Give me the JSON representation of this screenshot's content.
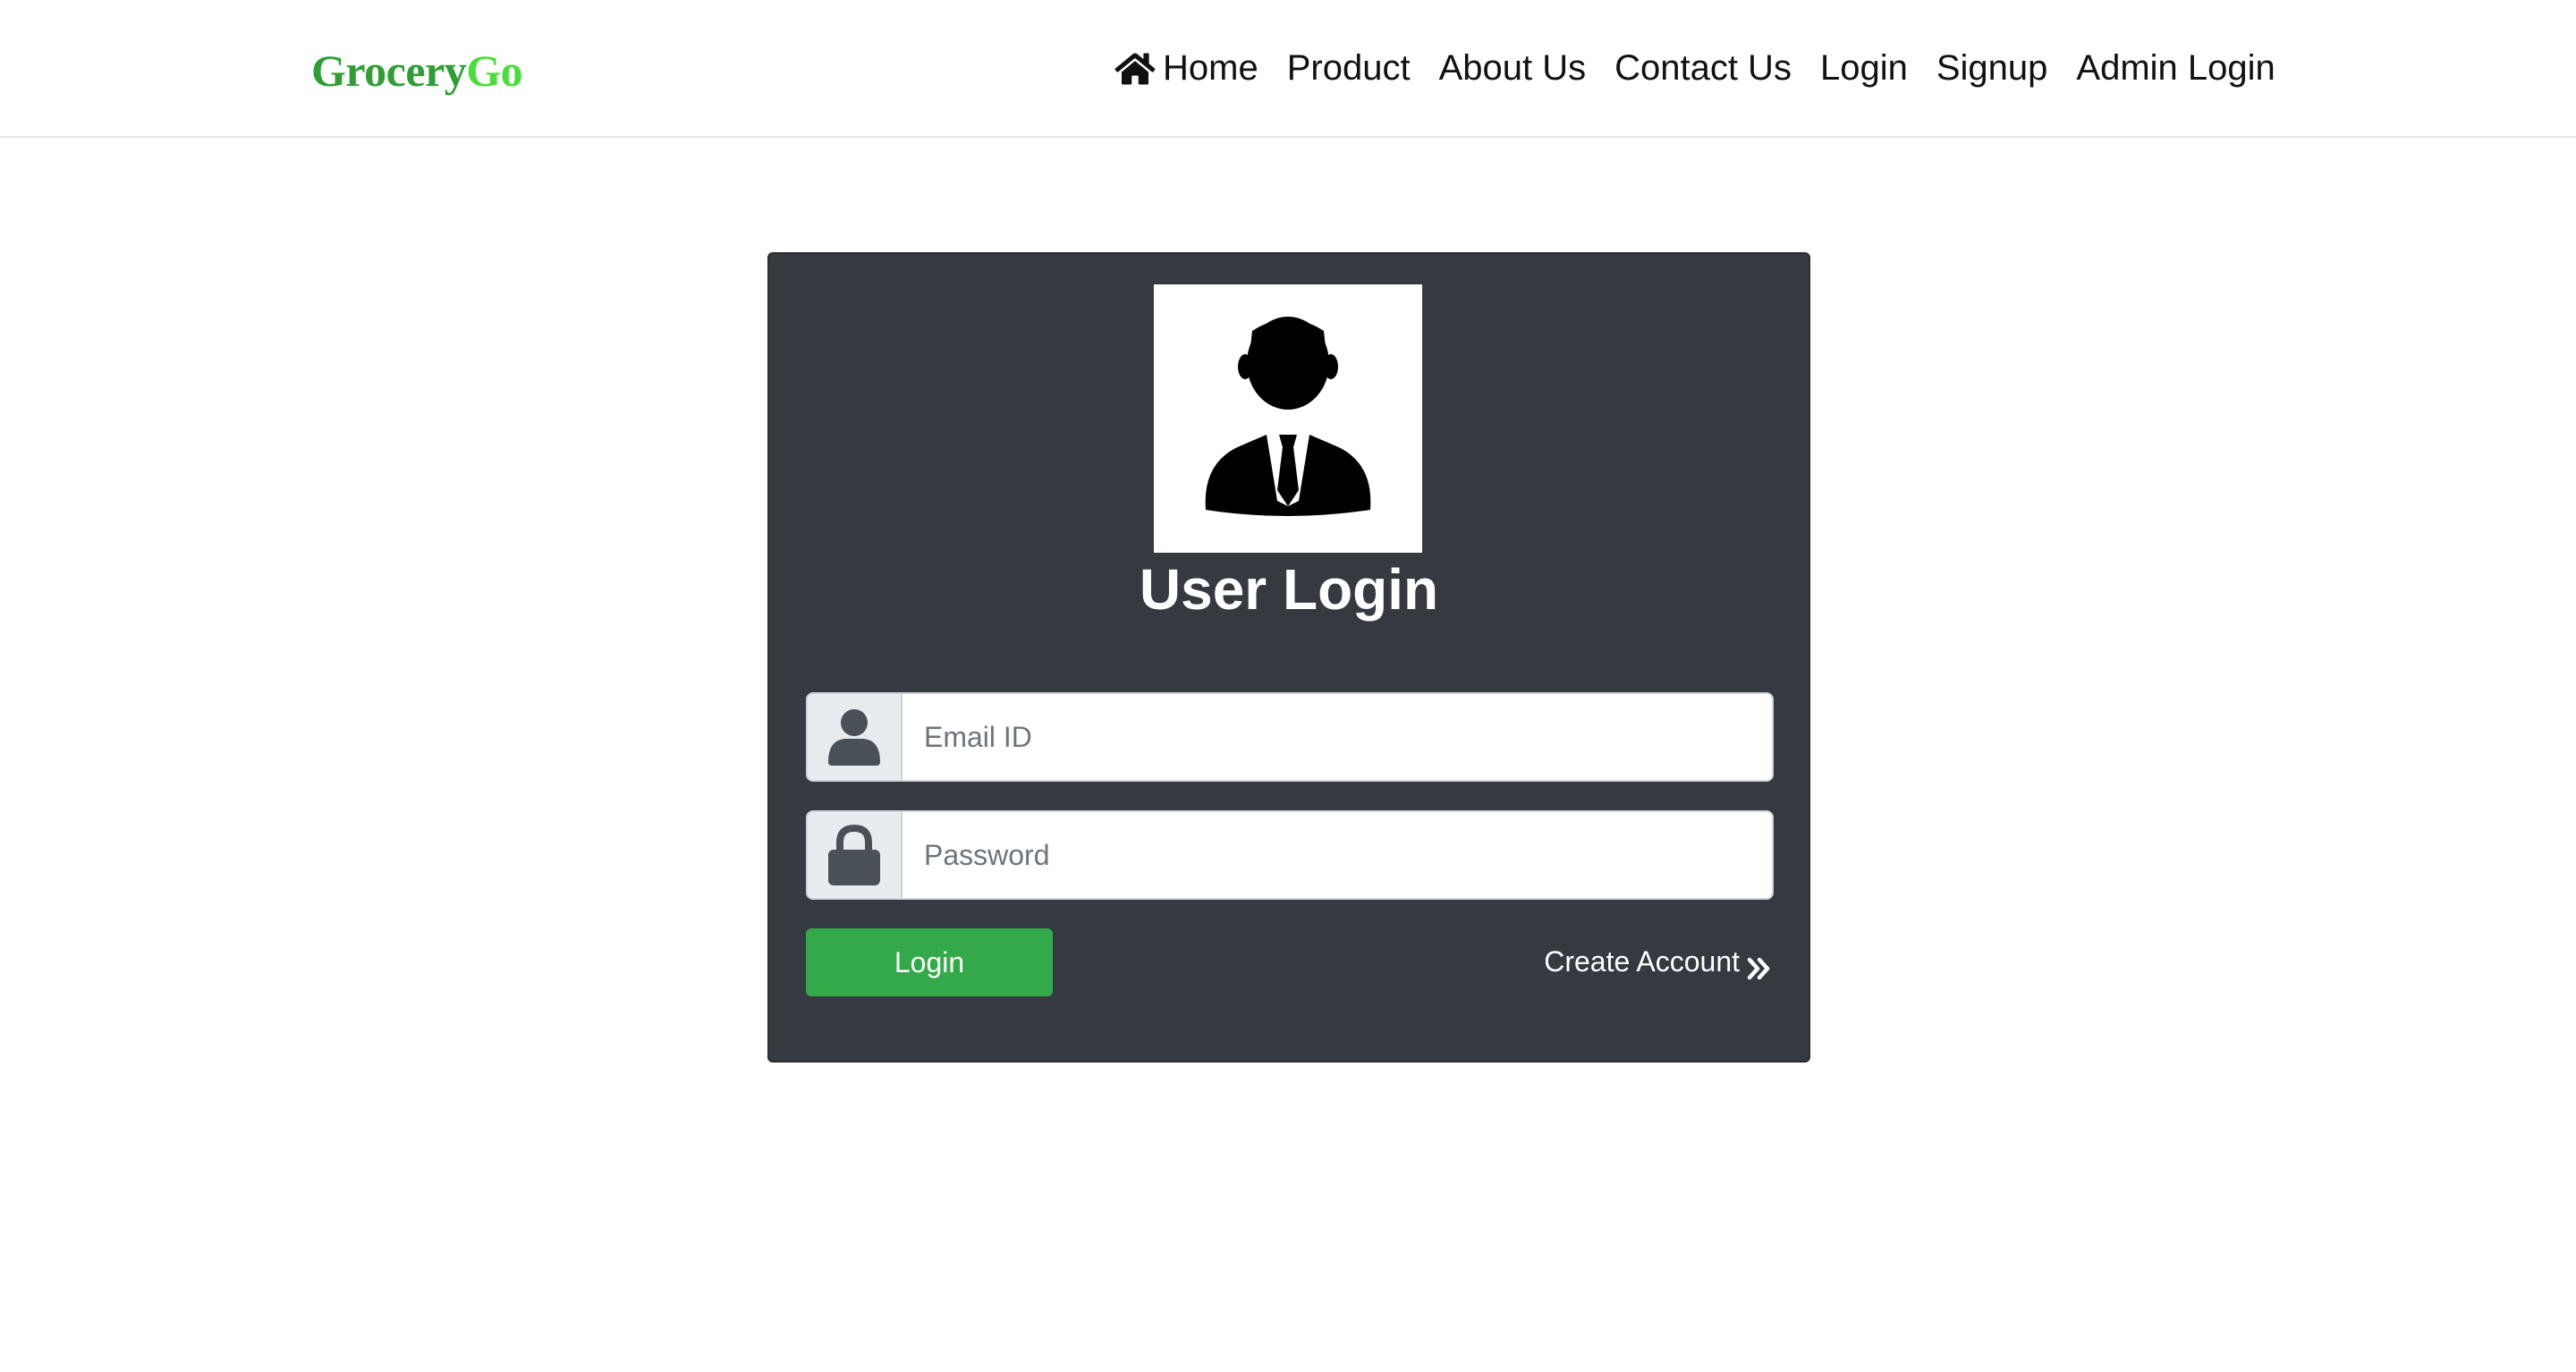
{
  "brand": {
    "part1": "Grocery",
    "part2": "Go"
  },
  "nav": {
    "items": [
      {
        "label": "Home",
        "icon": "home-icon"
      },
      {
        "label": "Product"
      },
      {
        "label": "About Us"
      },
      {
        "label": "Contact Us"
      },
      {
        "label": "Login"
      },
      {
        "label": "Signup"
      },
      {
        "label": "Admin Login"
      }
    ]
  },
  "login_card": {
    "avatar_icon": "user-avatar-icon",
    "title": "User Login",
    "email": {
      "placeholder": "Email ID",
      "value": "",
      "icon": "user-icon"
    },
    "password": {
      "placeholder": "Password",
      "value": "",
      "icon": "lock-icon"
    },
    "submit_label": "Login",
    "create_account_label": "Create Account",
    "create_account_icon": "double-chevron-right-icon"
  },
  "colors": {
    "brand_dark_green": "#2f9e35",
    "brand_light_green": "#4ade3b",
    "card_bg": "#343a40",
    "button_green": "#34a949",
    "addon_bg": "#e9ecef"
  }
}
